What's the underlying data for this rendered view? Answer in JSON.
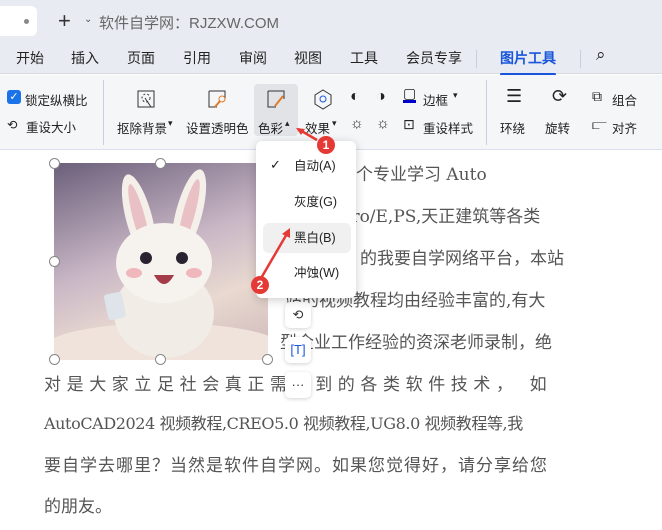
{
  "window": {
    "title": "软件自学网：RJZXW.COM"
  },
  "menu_tabs": [
    "开始",
    "插入",
    "页面",
    "引用",
    "审阅",
    "视图",
    "工具",
    "会员专享",
    "图片工具"
  ],
  "ribbon": {
    "lock_ratio": "锁定纵横比",
    "reset_size": "重设大小",
    "remove_bg": "抠除背景",
    "set_transparent": "设置透明色",
    "color": "色彩",
    "effects": "效果",
    "border": "边框",
    "reset_style": "重设样式",
    "wrap": "环绕",
    "rotate": "旋转",
    "group": "组合",
    "align": "对齐"
  },
  "color_menu": {
    "items": [
      "自动(A)",
      "灰度(G)",
      "黑白(B)",
      "冲蚀(W)"
    ],
    "checked": "自动(A)",
    "highlighted": "黑白(B)"
  },
  "annotations": [
    "1",
    "2"
  ],
  "document": {
    "lines": [
      "学网是一个专业学习 Auto",
      "Pro/E,PS,天正建筑等各类",
      "的我要自学网络平台，本站",
      "站的视频教程均由经验丰富的,有大",
      "型企业工作经验的资深老师录制，绝",
      "对是大家立足社会真正需用到的各类软件技术，  如",
      "AutoCAD2024 视频教程,CREO5.0 视频教程,UG8.0 视频教程等,我",
      "要自学去哪里？当然是软件自学网。如果您觉得好，请分享给您",
      "的朋友。"
    ]
  },
  "accent": "#1a56db"
}
